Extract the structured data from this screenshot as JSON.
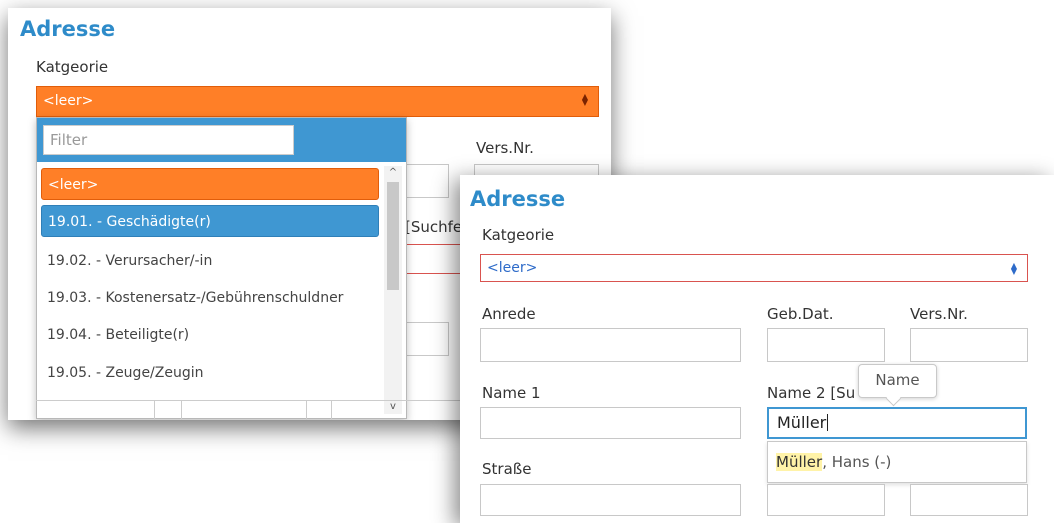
{
  "left_panel": {
    "title": "Adresse",
    "category_label": "Katgeorie",
    "category_value": "<leer>",
    "behind_labels": {
      "vers_nr": "Vers.Nr.",
      "suchfeld_fragment": "[Suchfe"
    },
    "dropdown": {
      "filter_placeholder": "Filter",
      "options": [
        "<leer>",
        "19.01. - Geschädigte(r)",
        "19.02. - Verursacher/-in",
        "19.03. - Kostenersatz-/Gebührenschuldner",
        "19.04. - Beteiligte(r)",
        "19.05. - Zeuge/Zeugin"
      ],
      "highlighted_option": "19.01. - Geschädigte(r)",
      "scroll_up_glyph": "^",
      "scroll_down_glyph": "v"
    }
  },
  "right_panel": {
    "title": "Adresse",
    "category_label": "Katgeorie",
    "category_value": "<leer>",
    "labels": {
      "anrede": "Anrede",
      "geb_dat": "Geb.Dat.",
      "vers_nr": "Vers.Nr.",
      "name1": "Name 1",
      "name2": "Name 2 [Su",
      "strasse": "Straße"
    },
    "name2_value": "Müller",
    "tooltip": "Name",
    "suggestion": {
      "match": "Müller",
      "rest": ", Hans (-)"
    }
  },
  "colors": {
    "title_blue": "#2e8bc9",
    "orange": "#ff7f27",
    "active_blue": "#3f97d2",
    "error_red": "#d9534f",
    "highlight_yellow": "#fff3a8"
  }
}
